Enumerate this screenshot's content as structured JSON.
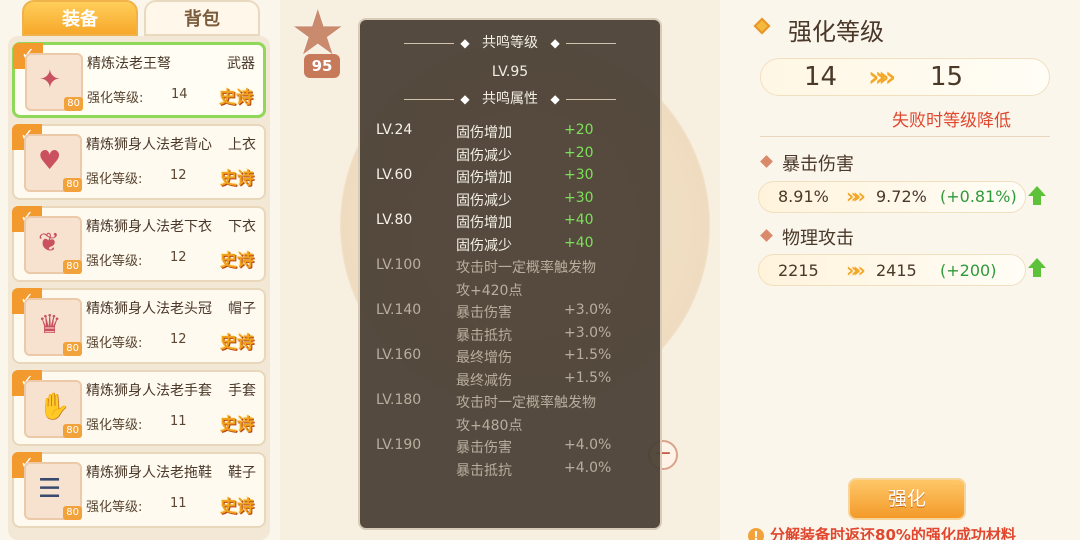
{
  "tabs": {
    "equip": "装备",
    "bag": "背包"
  },
  "items": [
    {
      "name": "精炼法老王弩",
      "slot": "武器",
      "level_label": "强化等级:",
      "level": "14",
      "quality": "史诗",
      "badge": "80"
    },
    {
      "name": "精炼狮身人法老背心",
      "slot": "上衣",
      "level_label": "强化等级:",
      "level": "12",
      "quality": "史诗",
      "badge": "80"
    },
    {
      "name": "精炼狮身人法老下衣",
      "slot": "下衣",
      "level_label": "强化等级:",
      "level": "12",
      "quality": "史诗",
      "badge": "80"
    },
    {
      "name": "精炼狮身人法老头冠",
      "slot": "帽子",
      "level_label": "强化等级:",
      "level": "12",
      "quality": "史诗",
      "badge": "80"
    },
    {
      "name": "精炼狮身人法老手套",
      "slot": "手套",
      "level_label": "强化等级:",
      "level": "11",
      "quality": "史诗",
      "badge": "80"
    },
    {
      "name": "精炼狮身人法老拖鞋",
      "slot": "鞋子",
      "level_label": "强化等级:",
      "level": "11",
      "quality": "史诗",
      "badge": "80"
    }
  ],
  "badge_level": "95",
  "popup": {
    "header": "共鸣等级",
    "level": "LV.95",
    "attr_header": "共鸣属性",
    "rows": [
      {
        "lv": "LV.24",
        "desc": "固伤增加",
        "val": "+20",
        "active": true
      },
      {
        "lv": "",
        "desc": "固伤减少",
        "val": "+20",
        "active": true
      },
      {
        "lv": "LV.60",
        "desc": "固伤增加",
        "val": "+30",
        "active": true
      },
      {
        "lv": "",
        "desc": "固伤减少",
        "val": "+30",
        "active": true
      },
      {
        "lv": "LV.80",
        "desc": "固伤增加",
        "val": "+40",
        "active": true
      },
      {
        "lv": "",
        "desc": "固伤减少",
        "val": "+40",
        "active": true
      },
      {
        "lv": "LV.100",
        "desc": "攻击时一定概率触发物",
        "val": "",
        "active": false
      },
      {
        "lv": "",
        "desc": "攻+420点",
        "val": "",
        "active": false
      },
      {
        "lv": "LV.140",
        "desc": "暴击伤害",
        "val": "+3.0%",
        "active": false
      },
      {
        "lv": "",
        "desc": "暴击抵抗",
        "val": "+3.0%",
        "active": false
      },
      {
        "lv": "LV.160",
        "desc": "最终增伤",
        "val": "+1.5%",
        "active": false
      },
      {
        "lv": "",
        "desc": "最终减伤",
        "val": "+1.5%",
        "active": false
      },
      {
        "lv": "LV.180",
        "desc": "攻击时一定概率触发物",
        "val": "",
        "active": false
      },
      {
        "lv": "",
        "desc": "攻+480点",
        "val": "",
        "active": false
      },
      {
        "lv": "LV.190",
        "desc": "暴击伤害",
        "val": "+4.0%",
        "active": false
      },
      {
        "lv": "",
        "desc": "暴击抵抗",
        "val": "+4.0%",
        "active": false
      }
    ]
  },
  "right": {
    "title": "强化等级",
    "level_from": "14",
    "level_to": "15",
    "fail_note": "失败时等级降低",
    "stats": [
      {
        "name": "暴击伤害",
        "from": "8.91%",
        "to": "9.72%",
        "diff": "(+0.81%)"
      },
      {
        "name": "物理攻击",
        "from": "2215",
        "to": "2415",
        "diff": "(+200)"
      }
    ],
    "enhance_button": "强化",
    "warning": "分解装备时返还80%的强化成功材料"
  },
  "colors": {
    "accent": "#f39a2a",
    "active_value": "#7de05a",
    "warning": "#e0472e",
    "gain": "#2f9a3a"
  }
}
